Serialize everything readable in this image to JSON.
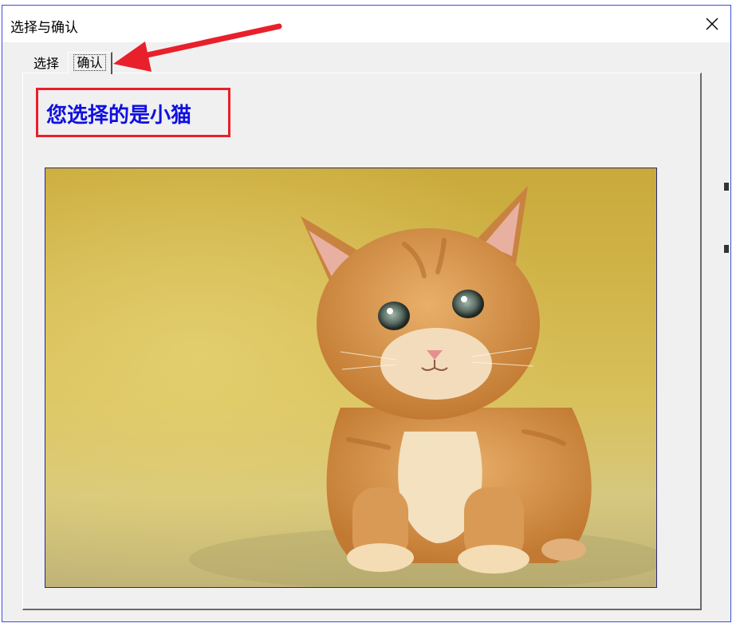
{
  "window": {
    "title": "选择与确认"
  },
  "tabs": [
    {
      "label": "选择",
      "selected": false
    },
    {
      "label": "确认",
      "selected": true
    }
  ],
  "result": {
    "text": "您选择的是小猫"
  },
  "image": {
    "subject": "kitten-photo"
  },
  "colors": {
    "result_text": "#1010e0",
    "highlight_border": "#e8202c",
    "arrow": "#e8202c",
    "window_border": "#3c4fd6"
  },
  "icons": {
    "close": "close-icon",
    "annotation": "red-arrow-icon"
  }
}
